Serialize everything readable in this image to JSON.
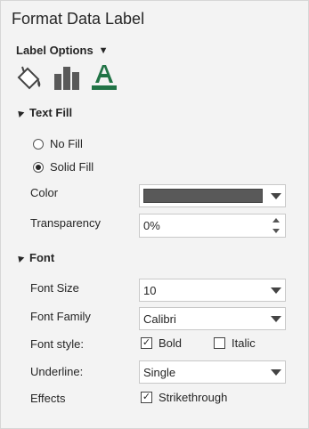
{
  "pane": {
    "title": "Format Data Label"
  },
  "label_options": {
    "label": "Label Options",
    "caret": "▼"
  },
  "icons": [
    "fill-line-icon",
    "size-properties-icon",
    "text-options-icon"
  ],
  "text_fill": {
    "header": "Text Fill",
    "no_fill": "No Fill",
    "solid_fill": "Solid Fill",
    "selected": "Solid Fill",
    "color_label": "Color",
    "color_value": "#595959",
    "transparency_label": "Transparency",
    "transparency_value": "0%"
  },
  "font": {
    "header": "Font",
    "size_label": "Font Size",
    "size_value": "10",
    "family_label": "Font Family",
    "family_value": "Calibri",
    "style_label": "Font style:",
    "bold_label": "Bold",
    "bold_checked": true,
    "italic_label": "Italic",
    "italic_checked": false,
    "underline_label": "Underline:",
    "underline_value": "Single",
    "effects_label": "Effects",
    "strike_label": "Strikethrough",
    "strike_checked": true
  },
  "colors": {
    "accent": "#217346",
    "icon_gray": "#595959"
  }
}
